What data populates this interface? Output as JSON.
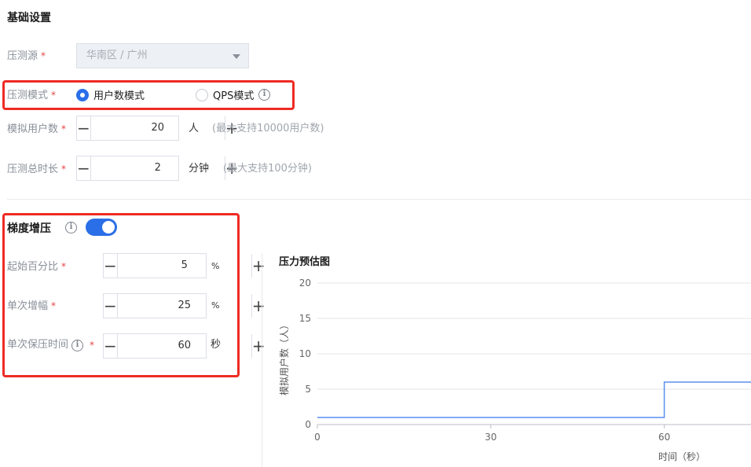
{
  "basic": {
    "section_title": "基础设置",
    "source_label": "压测源",
    "source_value": "华南区 / 广州",
    "mode_label": "压测模式",
    "mode_options": [
      "用户数模式",
      "QPS模式"
    ],
    "mode_selected": 0,
    "users_label": "模拟用户数",
    "users_value": "20",
    "users_unit": "人",
    "users_hint": "(最大支持10000用户数)",
    "duration_label": "压测总时长",
    "duration_value": "2",
    "duration_unit": "分钟",
    "duration_hint": "(最大支持100分钟)",
    "required_mark": "*"
  },
  "ramp": {
    "section_title": "梯度增压",
    "enabled": true,
    "start_percent_label": "起始百分比",
    "start_percent_value": "5",
    "start_percent_unit": "%",
    "step_label": "单次增幅",
    "step_value": "25",
    "step_unit": "%",
    "hold_label": "单次保压时间",
    "hold_value": "60",
    "hold_unit": "秒"
  },
  "icons": {
    "info": "i",
    "minus": "−",
    "plus": "+"
  },
  "colors": {
    "accent": "#2b6fe8",
    "highlight": "#ee2b24",
    "required": "#e54545",
    "line": "#5b8ff0"
  },
  "chart_data": {
    "type": "line",
    "title": "压力预估图",
    "xlabel": "时间（秒）",
    "ylabel": "模拟用户数（人）",
    "xlim": [
      0,
      75
    ],
    "ylim": [
      0,
      20
    ],
    "x_ticks": [
      0,
      30,
      60
    ],
    "y_ticks": [
      0,
      5,
      10,
      15,
      20
    ],
    "grid": true,
    "series": [
      {
        "x": [
          0,
          60,
          60,
          75
        ],
        "y": [
          1,
          1,
          6,
          6
        ],
        "step": true
      }
    ]
  }
}
